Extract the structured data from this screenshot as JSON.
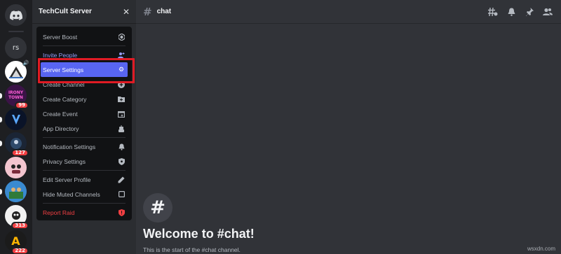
{
  "server": {
    "name": "TechCult Server"
  },
  "rail": {
    "text_server": "rs",
    "badges": [
      "99",
      "127",
      "313",
      "222"
    ]
  },
  "menu": {
    "items": [
      {
        "label": "Server Boost",
        "icon": "boost-icon"
      },
      {
        "label": "Invite People",
        "icon": "add-person-icon"
      },
      {
        "label": "Server Settings",
        "icon": "gear-icon"
      },
      {
        "label": "Create Channel",
        "icon": "plus-circle-icon"
      },
      {
        "label": "Create Category",
        "icon": "folder-plus-icon"
      },
      {
        "label": "Create Event",
        "icon": "calendar-plus-icon"
      },
      {
        "label": "App Directory",
        "icon": "robot-icon"
      },
      {
        "label": "Notification Settings",
        "icon": "bell-icon"
      },
      {
        "label": "Privacy Settings",
        "icon": "shield-icon"
      },
      {
        "label": "Edit Server Profile",
        "icon": "pencil-icon"
      },
      {
        "label": "Hide Muted Channels",
        "icon": "checkbox-icon"
      },
      {
        "label": "Report Raid",
        "icon": "shield-alert-icon"
      }
    ]
  },
  "channel": {
    "hash": "#",
    "name": "chat"
  },
  "welcome": {
    "title": "Welcome to #chat!",
    "subtitle": "This is the start of the #chat channel."
  },
  "watermark": "wsxdn.com",
  "colors": {
    "accent": "#5865f2",
    "danger": "#f23f42",
    "highlight_box": "#e01b24"
  }
}
